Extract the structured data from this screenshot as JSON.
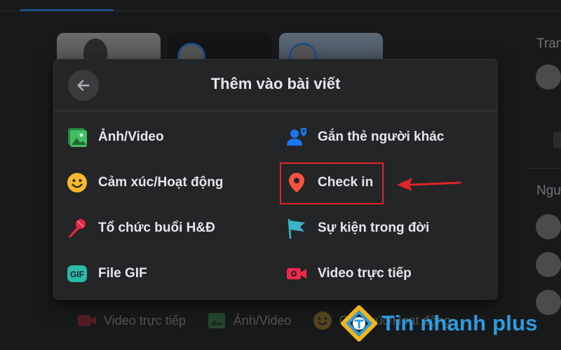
{
  "dialog": {
    "title": "Thêm vào bài viết",
    "options": [
      {
        "label": "Ảnh/Video",
        "icon": "photo-video-icon",
        "color": "#45bd62"
      },
      {
        "label": "Gắn thẻ người khác",
        "icon": "tag-people-icon",
        "color": "#1877f2"
      },
      {
        "label": "Cảm xúc/Hoạt động",
        "icon": "feeling-smiley-icon",
        "color": "#f7b928"
      },
      {
        "label": "Check in",
        "icon": "location-pin-icon",
        "color": "#f5533d"
      },
      {
        "label": "Tổ chức buổi H&Đ",
        "icon": "microphone-icon",
        "color": "#e42645"
      },
      {
        "label": "Sự kiện trong đời",
        "icon": "life-event-flag-icon",
        "color": "#3bb4c8"
      },
      {
        "label": "File GIF",
        "icon": "gif-icon",
        "color": "#2abba7"
      },
      {
        "label": "Video trực tiếp",
        "icon": "live-video-icon",
        "color": "#f02849"
      }
    ],
    "highlight_color": "#e0242b"
  },
  "background": {
    "sidebar_title_1": "Trang",
    "sidebar_title_2": "Người",
    "actions": [
      {
        "label": "Video trực tiếp",
        "icon": "live-video-icon"
      },
      {
        "label": "Ảnh/Video",
        "icon": "photo-video-icon"
      },
      {
        "label": "Cảm xúc/Hoạt động",
        "icon": "feeling-smiley-icon"
      }
    ]
  },
  "watermark": {
    "text": "Tin nhanh plus",
    "color": "#2d9be0"
  }
}
